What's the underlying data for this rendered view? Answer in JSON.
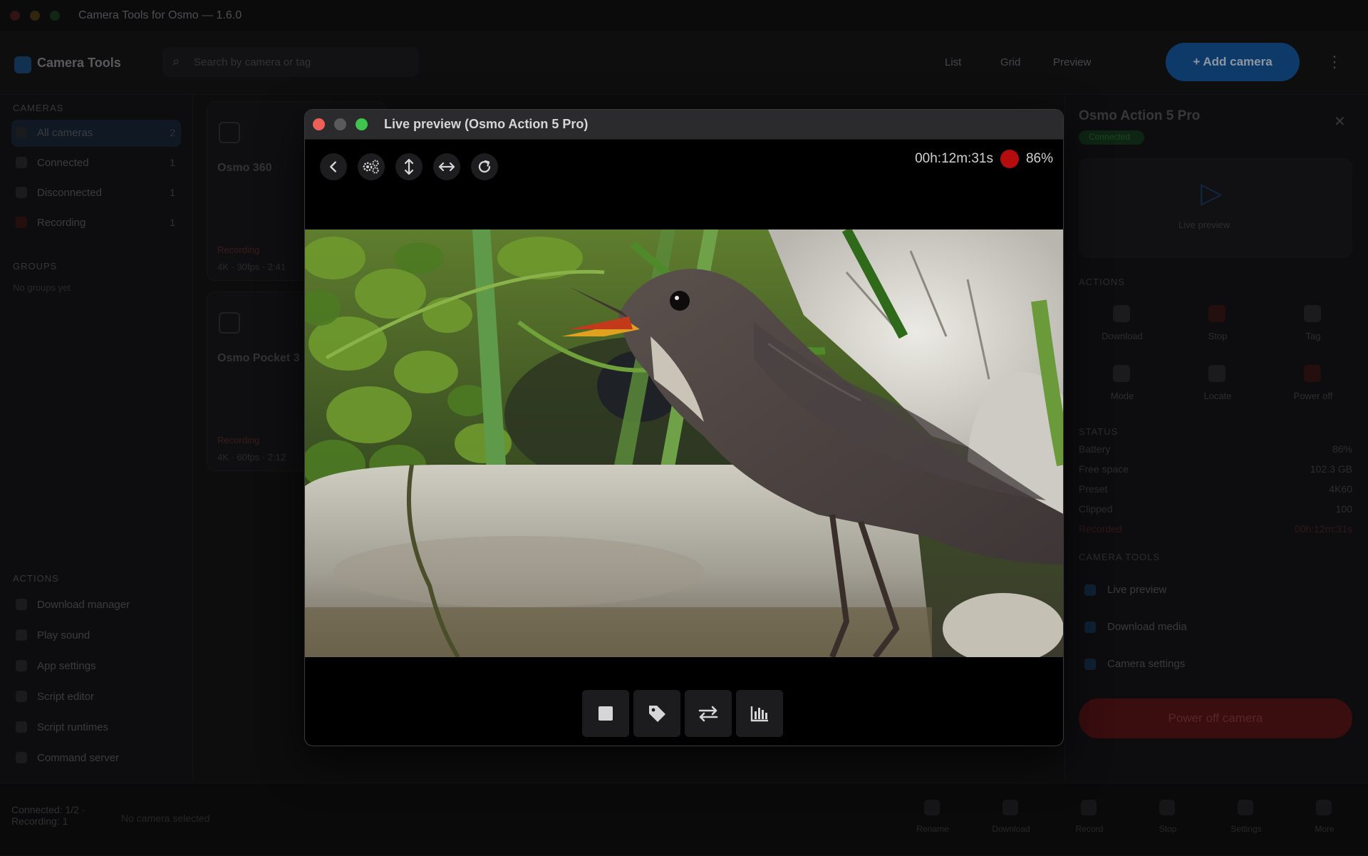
{
  "app": {
    "title": "Camera Tools for Osmo — 1.6.0",
    "brand": "Camera Tools",
    "search_placeholder": "Search by camera or tag",
    "header_toggles": [
      "List",
      "Grid",
      "Preview"
    ],
    "add_camera_label": "+ Add camera",
    "sidebar": {
      "cameras_section": "CAMERAS",
      "items": [
        {
          "label": "All cameras",
          "count": "2"
        },
        {
          "label": "Connected",
          "count": "1"
        },
        {
          "label": "Disconnected",
          "count": "1"
        },
        {
          "label": "Recording",
          "count": "1"
        }
      ],
      "groups_section": "GROUPS",
      "groups_empty": "No groups yet",
      "actions_section": "ACTIONS",
      "actions": [
        "Download manager",
        "Play sound",
        "App settings",
        "Script editor",
        "Script runtimes",
        "Command server"
      ]
    },
    "cards": [
      {
        "name": "Osmo 360",
        "status": "Recording",
        "meta": "4K · 30fps · 2:41"
      },
      {
        "name": "Osmo Pocket 3",
        "status": "Recording",
        "meta": "4K · 60fps · 2:12"
      }
    ],
    "right_panel": {
      "title": "Osmo Action 5 Pro",
      "badge": "Connected",
      "preview_label": "Live preview",
      "actions_section": "ACTIONS",
      "actions": [
        "Download",
        "Stop",
        "Tag",
        "Mode",
        "Locate",
        "Power off"
      ],
      "status_section": "STATUS",
      "status_rows": [
        {
          "label": "Battery",
          "value": "86%"
        },
        {
          "label": "Free space",
          "value": "102.3 GB"
        },
        {
          "label": "Preset",
          "value": "4K60"
        },
        {
          "label": "Clipped",
          "value": "100"
        },
        {
          "label": "Recorded",
          "value": "00h:12m:31s"
        }
      ],
      "links_section": "CAMERA TOOLS",
      "links": [
        "Live preview",
        "Download media",
        "Camera settings"
      ],
      "power_off_label": "Power off camera"
    },
    "statusbar": {
      "connection": "Connected: 1/2 · Recording: 1",
      "bulk": "No camera selected",
      "buttons": [
        "Rename",
        "Download",
        "Record",
        "Stop",
        "Settings",
        "More"
      ]
    }
  },
  "live_preview": {
    "title": "Live preview (Osmo Action 5 Pro)",
    "timer": "00h:12m:31s",
    "battery": "86%",
    "colors": {
      "rec": "#b50d0d",
      "close": "#ed5f57",
      "minimize": "#5a5a5c",
      "maximize": "#3fc44e"
    },
    "toolbar_icons": [
      "chevron-left-icon",
      "settings-gears-icon",
      "vertical-arrows-icon",
      "horizontal-arrows-icon",
      "refresh-icon"
    ],
    "bottom_icons": [
      "stop-icon",
      "tag-icon",
      "swap-icon",
      "levels-icon"
    ]
  }
}
